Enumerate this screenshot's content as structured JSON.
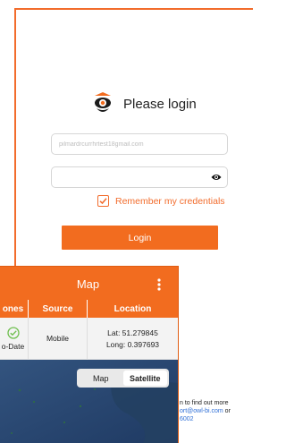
{
  "login": {
    "title": "Please login",
    "email_value": "pilmardrcurrhrtest18gmail.com",
    "remember_label": "Remember my credentials",
    "login_button": "Login"
  },
  "help": {
    "line1": "n to find out more",
    "line2_link": "ort@owl-bi.com",
    "line2_suffix": " or",
    "line3_link": "6002"
  },
  "map_panel": {
    "title": "Map",
    "columns": [
      "ones",
      "Source",
      "Location"
    ],
    "row": {
      "status": "o-Date",
      "source": "Mobile",
      "lat": "Lat: 51.279845",
      "long": "Long: 0.397693"
    },
    "map_types": [
      "Map",
      "Satellite"
    ],
    "selected_map_type": "Satellite"
  },
  "colors": {
    "accent": "#f26c1f",
    "link": "#2f6fd6",
    "check": "#6fbf4f",
    "ocean": "#27426b"
  },
  "icons": [
    "owl-logo-icon",
    "eye-icon",
    "checkbox-checked-icon",
    "more-vert-icon",
    "check-circle-icon"
  ]
}
